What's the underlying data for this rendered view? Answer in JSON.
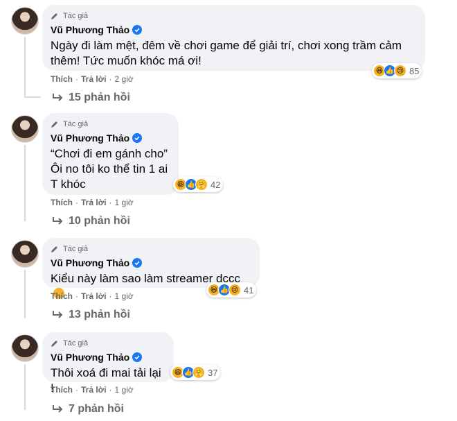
{
  "comments": [
    {
      "badge": "Tác giả",
      "author": "Vũ Phương Thảo",
      "lines": [
        "Ngày đi làm mệt, đêm về chơi game để giải trí, chơi xong trầm cảm",
        "thêm! Tức muốn khóc má ơi!"
      ],
      "reaction_count": "85",
      "reactions": [
        "haha",
        "like",
        "sad"
      ],
      "like_label": "Thích",
      "reply_label": "Trả lời",
      "time": "2 giờ",
      "replies": "15 phản hồi"
    },
    {
      "badge": "Tác giả",
      "author": "Vũ Phương Thảo",
      "lines": [
        "“Chơi đi em gánh cho”",
        "Ôi no tôi ko thể tin 1 ai",
        "T khóc"
      ],
      "reaction_count": "42",
      "reactions": [
        "haha",
        "like",
        "care"
      ],
      "like_label": "Thích",
      "reply_label": "Trả lời",
      "time": "1 giờ",
      "replies": "10 phản hồi"
    },
    {
      "badge": "Tác giả",
      "author": "Vũ Phương Thảo",
      "lines": [
        "Kiểu này làm sao làm streamer dccc"
      ],
      "reaction_count": "41",
      "reactions": [
        "haha",
        "like",
        "sad"
      ],
      "like_label": "Thích",
      "reply_label": "Trả lời",
      "time": "1 giờ",
      "replies": "13 phản hồi"
    },
    {
      "badge": "Tác giả",
      "author": "Vũ Phương Thảo",
      "lines": [
        "Thôi xoá đi mai tải lại !"
      ],
      "reaction_count": "37",
      "reactions": [
        "haha",
        "like",
        "care"
      ],
      "like_label": "Thích",
      "reply_label": "Trả lời",
      "time": "1 giờ",
      "replies": "7 phản hồi"
    }
  ],
  "colors": {
    "bubble": "#f0f2f5",
    "meta": "#65676b",
    "verified": "#1877f2"
  }
}
